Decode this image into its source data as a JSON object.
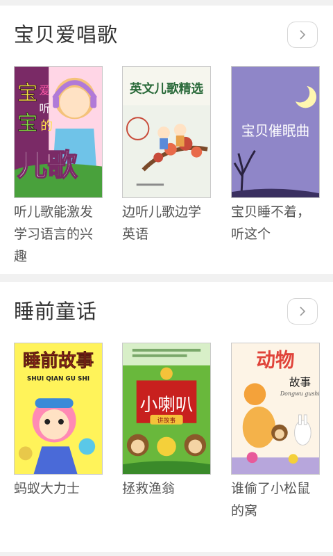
{
  "sections": [
    {
      "title": "宝贝爱唱歌",
      "more_icon": "chevron-right-icon",
      "items": [
        {
          "title": "听儿歌能激发学习语言的兴趣",
          "cover_text": [
            "宝",
            "爱",
            "听",
            "宝",
            "的",
            "儿歌"
          ],
          "cover_colors": {
            "bg": "#7a2a66",
            "sky": "#ffd6e6",
            "grass": "#49a13c"
          }
        },
        {
          "title": "边听儿歌边学英语",
          "cover_text": [
            "英文儿歌精选"
          ],
          "cover_colors": {
            "bg": "#eef2ea",
            "title": "#2a6a3a",
            "tree": "#c84b3a"
          }
        },
        {
          "title": "宝贝睡不着，听这个",
          "cover_text": [
            "宝贝催眠曲"
          ],
          "cover_colors": {
            "bg": "#8f86c8",
            "moon": "#fff7b0"
          }
        }
      ]
    },
    {
      "title": "睡前童话",
      "more_icon": "chevron-right-icon",
      "items": [
        {
          "title": "蚂蚁大力士",
          "cover_text": [
            "睡前故事",
            "SHUI QIAN GU SHI"
          ],
          "cover_colors": {
            "bg": "#fff35a",
            "title": "#e23c2a"
          }
        },
        {
          "title": "拯救渔翁",
          "cover_text": [
            "小喇叭",
            "讲故事"
          ],
          "cover_colors": {
            "bg": "#69b83c",
            "banner": "#c8201e"
          }
        },
        {
          "title": "谁偷了小松鼠的窝",
          "cover_text": [
            "动物",
            "故事",
            "Dongwu gushi"
          ],
          "cover_colors": {
            "bg": "#fdf4e6",
            "title": "#e0433a",
            "strip": "#b7a6dc"
          }
        }
      ]
    }
  ]
}
